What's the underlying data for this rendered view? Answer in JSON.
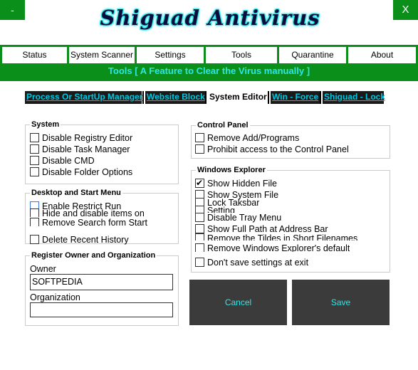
{
  "window": {
    "minimize_label": "-",
    "close_label": "X"
  },
  "app": {
    "title": "Shiguad Antivirus"
  },
  "nav": {
    "tabs": [
      "Status",
      "System Scanner",
      "Settings",
      "Tools",
      "Quarantine",
      "About"
    ]
  },
  "page": {
    "subtitle": "Tools [ A Feature to Clear the Virus manually ]"
  },
  "subtabs": [
    "Process Or StartUp Manager",
    "Website Block",
    "System Editor",
    "Win - Force",
    "Shiguad - Lock"
  ],
  "system_group": {
    "title": "System",
    "items": [
      {
        "label": "Disable Registry Editor",
        "checked": false
      },
      {
        "label": "Disable Task Manager",
        "checked": false
      },
      {
        "label": "Disable CMD",
        "checked": false
      },
      {
        "label": "Disable Folder Options",
        "checked": false
      }
    ]
  },
  "desktop_group": {
    "title": "Desktop and Start Menu",
    "items": [
      {
        "label": "Enable Restrict Run",
        "checked": false
      },
      {
        "label": "Hide and disable items on",
        "checked": false
      },
      {
        "label": "Remove Search form Start",
        "checked": false
      },
      {
        "label": "Delete Recent History",
        "checked": false
      }
    ]
  },
  "register_group": {
    "title": "Register Owner and Organization",
    "owner_label": "Owner",
    "owner_value": "SOFTPEDIA",
    "organization_label": "Organization",
    "organization_value": ""
  },
  "control_group": {
    "title": "Control Panel",
    "items": [
      {
        "label": "Remove Add/Programs",
        "checked": false
      },
      {
        "label": "Prohibit access to the Control Panel",
        "checked": false
      }
    ]
  },
  "explorer_group": {
    "title": "Windows Explorer",
    "items": [
      {
        "label": "Show Hidden File",
        "checked": true
      },
      {
        "label": "Show System File",
        "checked": false
      },
      {
        "label": "Lock Taksbar",
        "checked": false
      },
      {
        "label": "Setting",
        "checked": false
      },
      {
        "label": "Disable Tray Menu",
        "checked": false
      },
      {
        "label": "Show Full Path at Address Bar",
        "checked": false
      },
      {
        "label": "Remove the Tildes in Short Filenames",
        "checked": false
      },
      {
        "label": "Remove Windows Explorer's default",
        "checked": false
      },
      {
        "label": "Don't save settings at exit",
        "checked": false
      }
    ]
  },
  "actions": {
    "cancel_label": "Cancel",
    "save_label": "Save"
  },
  "colors": {
    "accent_green": "#0a8f1a",
    "cyan": "#2fe6e6",
    "dark_button": "#3b3b3b"
  }
}
